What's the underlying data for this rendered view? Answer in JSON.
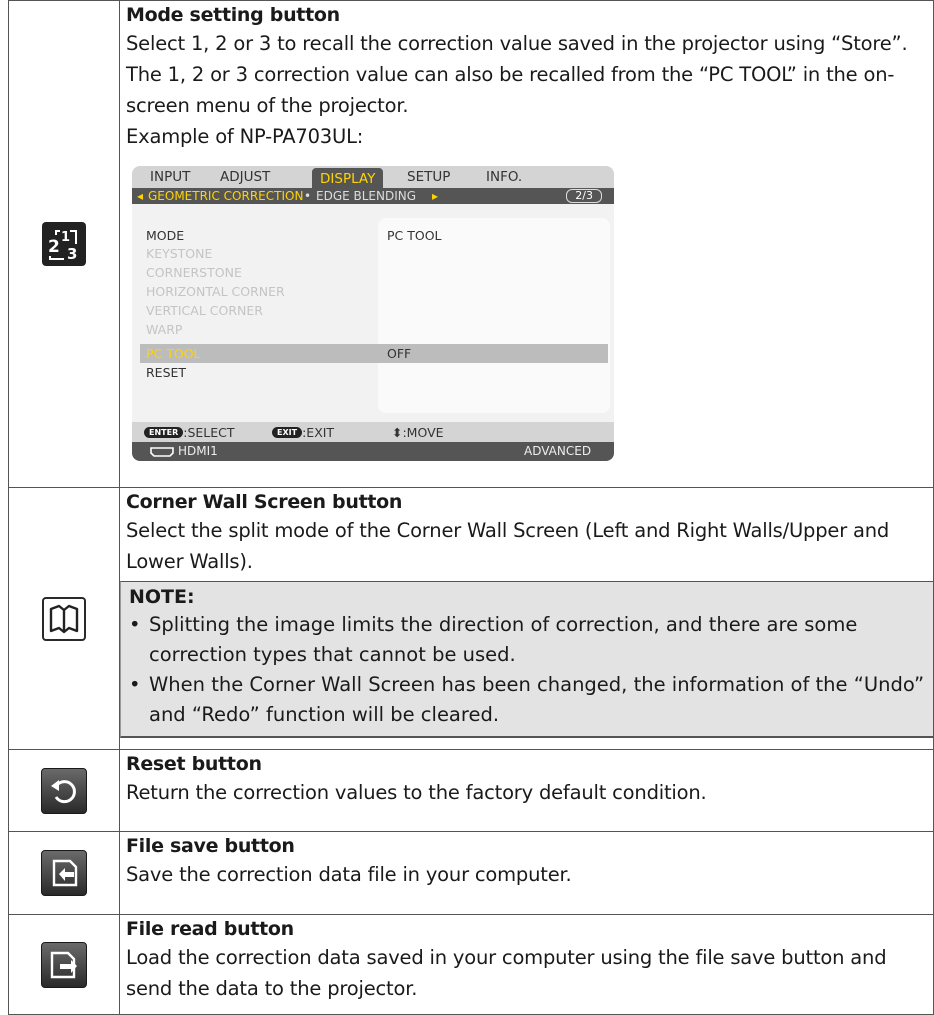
{
  "rows": {
    "mode": {
      "icon": "mode-123-icon",
      "title": "Mode setting button",
      "lines": [
        "Select 1, 2 or 3 to recall the correction value saved in the projector using “Store”.",
        "The 1, 2 or 3 correction value can also be recalled from the “PC TOOL” in the on-",
        "screen menu of the projector.",
        "Example of NP-PA703UL:"
      ]
    },
    "corner": {
      "icon": "open-book-icon",
      "title": "Corner Wall Screen button",
      "lines": [
        "Select the split mode of the Corner Wall Screen (Left and Right Walls/Upper and",
        "Lower Walls)."
      ],
      "note_title": "NOTE:",
      "note_items": [
        "Splitting the image limits the direction of correction, and there are some correction types that cannot be used.",
        "When the Corner Wall Screen has been changed, the information of the “Undo” and “Redo” function will be cleared."
      ],
      "bullet": "•"
    },
    "reset": {
      "icon": "reset-arrow-icon",
      "title": "Reset button",
      "text": "Return the correction values to the factory default condition."
    },
    "save": {
      "icon": "file-save-icon",
      "title": "File save button",
      "text": "Save the correction data file in your computer."
    },
    "read": {
      "icon": "file-read-icon",
      "title": "File read button",
      "lines": [
        "Load the correction data saved in your computer using the file save button and",
        "send the data to the projector."
      ]
    }
  },
  "osd": {
    "tabs": [
      "INPUT",
      "ADJUST",
      "DISPLAY",
      "SETUP",
      "INFO."
    ],
    "active_tab": "DISPLAY",
    "sub_left_arrow": "◂",
    "sub_active": "GEOMETRIC CORRECTION",
    "sub_sep": "•",
    "sub_other": "EDGE BLENDING",
    "sub_right_arrow": "▸",
    "page": "2/3",
    "items": [
      {
        "label": "MODE",
        "dim": false
      },
      {
        "label": "KEYSTONE",
        "dim": true
      },
      {
        "label": "CORNERSTONE",
        "dim": true
      },
      {
        "label": "HORIZONTAL CORNER",
        "dim": true
      },
      {
        "label": "VERTICAL CORNER",
        "dim": true
      },
      {
        "label": "WARP",
        "dim": true
      },
      {
        "label": "PC TOOL",
        "dim": false
      },
      {
        "label": "RESET",
        "dim": false
      }
    ],
    "mode_value": "PC TOOL",
    "pctool_value": "OFF",
    "enter_key": "ENTER",
    "enter_label": ":SELECT",
    "exit_key": "EXIT",
    "exit_label": ":EXIT",
    "move_label": "⬍:MOVE",
    "source": "HDMI1",
    "status_right": "ADVANCED",
    "colors": {
      "active": "#ffd400",
      "bar": "#555555",
      "tabbar": "#d4d4d4"
    }
  }
}
